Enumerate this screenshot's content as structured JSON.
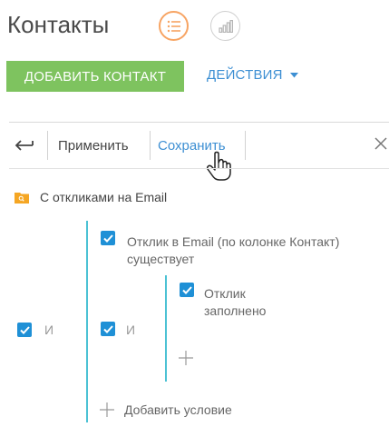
{
  "header": {
    "title": "Контакты"
  },
  "toolbar": {
    "add_contact": "ДОБАВИТЬ КОНТАКТ",
    "actions": "ДЕЙСТВИЯ"
  },
  "filter_toolbar": {
    "apply": "Применить",
    "save": "Сохранить"
  },
  "filter": {
    "folder_name": "С откликами на Email",
    "root_operator": "И",
    "group_operator": "И",
    "condition1": {
      "line1": "Отклик в Email (по колонке Контакт)",
      "line2": "существует"
    },
    "condition2": {
      "line1": "Отклик",
      "line2": "заполнено"
    },
    "add_condition": "Добавить условие"
  },
  "colors": {
    "accent_orange": "#f7a463",
    "green_button": "#7ec35f",
    "link_blue": "#3d8fd3",
    "checkbox_blue": "#1f90d6",
    "tree_line": "#4cc2d4",
    "folder_orange": "#f5a623"
  },
  "icons": [
    "list-icon",
    "chart-icon",
    "back-arrow-icon",
    "close-icon",
    "hand-cursor-icon",
    "folder-search-icon",
    "checkbox-icon",
    "plus-icon",
    "caret-down-icon"
  ]
}
